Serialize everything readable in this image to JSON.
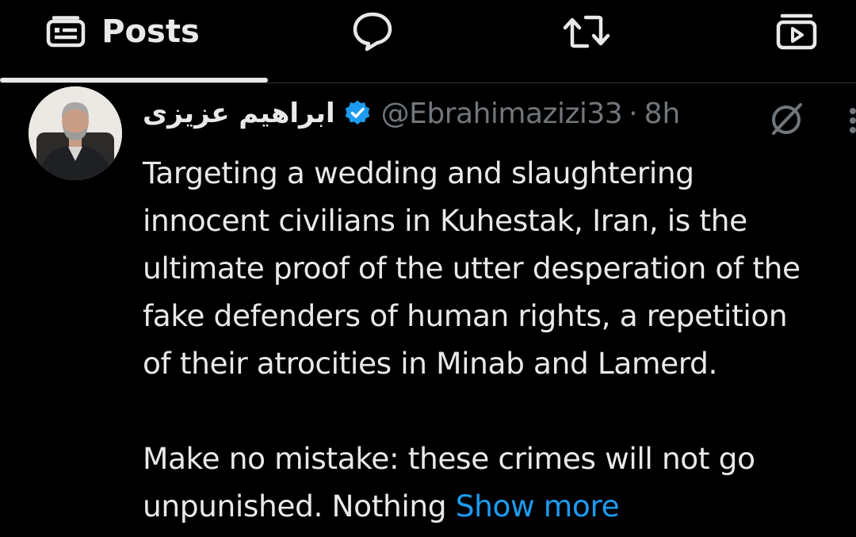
{
  "tabs": {
    "posts_label": "Posts",
    "active": "posts",
    "icons": [
      "posts-icon",
      "replies-icon",
      "reposts-icon",
      "media-icon"
    ]
  },
  "post": {
    "display_name": "ابراهیم عزیزی",
    "verified": true,
    "handle": "@Ebrahimazizi33",
    "separator": "·",
    "time": "8h",
    "text_lines": [
      "Targeting a wedding and slaughtering",
      "innocent civilians in Kuhestak, Iran, is the",
      "ultimate proof of the utter desperation of the",
      "fake defenders of human rights, a repetition",
      "of their atrocities in Minab and Lamerd."
    ],
    "text_lines_2": [
      "Make no mistake: these crimes will not go"
    ],
    "last_line_text": "unpunished. Nothing ",
    "show_more": "Show more"
  },
  "colors": {
    "background": "#000000",
    "text_primary": "#e7e9ea",
    "text_secondary": "#71767b",
    "accent": "#1d9bf0",
    "verified_badge": "#1d9bf0",
    "tab_indicator": "#e7e9ea",
    "divider": "#2f3336"
  }
}
